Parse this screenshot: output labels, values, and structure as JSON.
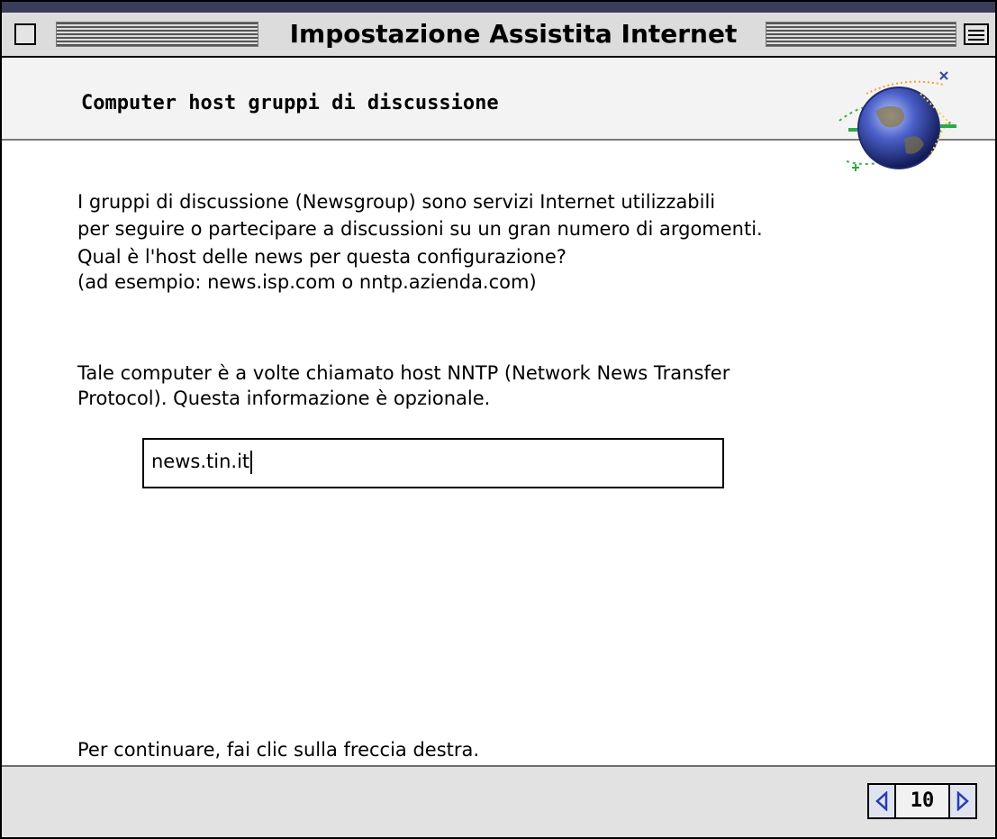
{
  "window": {
    "title": "Impostazione Assistita Internet"
  },
  "header": {
    "title": "Computer host gruppi di discussione"
  },
  "body": {
    "lines": [
      "I gruppi di discussione (Newsgroup) sono servizi Internet utilizzabili",
      "per seguire o partecipare a discussioni su un gran numero di argomenti.",
      "Qual è l'host delle news per questa configurazione?",
      "(ad esempio: news.isp.com o nntp.azienda.com)",
      "Tale computer è a volte chiamato host NNTP (Network News Transfer",
      "Protocol). Questa informazione è opzionale."
    ],
    "news_host_value": "news.tin.it",
    "continue_instruction": "Per continuare, fai clic sulla freccia destra."
  },
  "footer": {
    "page_number": "10"
  },
  "icons": {
    "close": "close-box-icon",
    "collapse": "collapse-box-icon",
    "globe": "internet-globe-icon",
    "prev": "left-arrow-icon",
    "next": "right-arrow-icon"
  }
}
